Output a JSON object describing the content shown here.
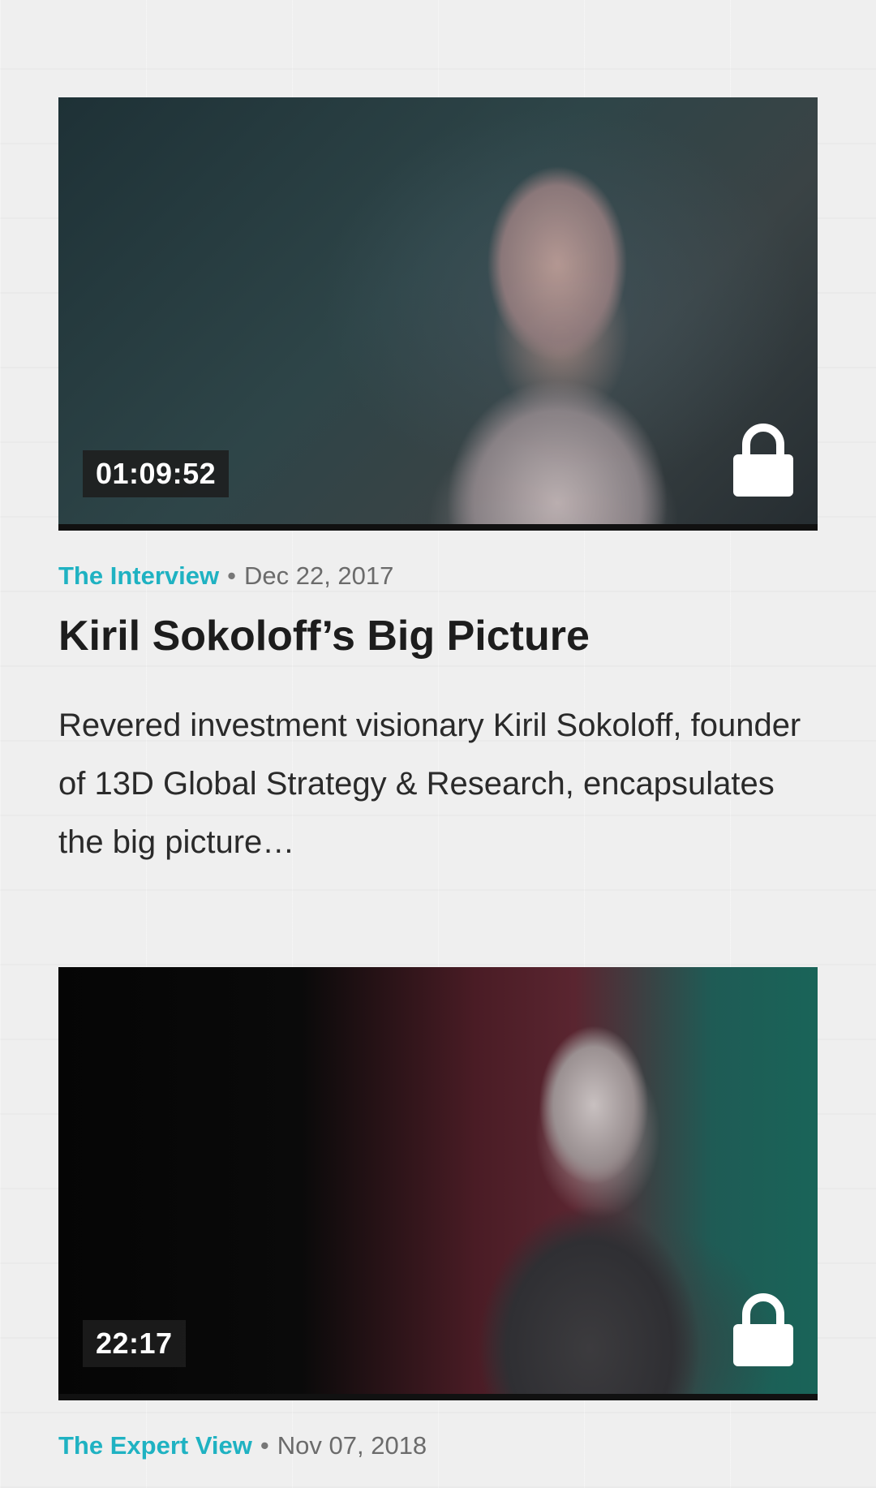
{
  "articles": [
    {
      "duration": "01:09:52",
      "category": "The Interview",
      "separator": "•",
      "date": "Dec 22, 2017",
      "title": "Kiril Sokoloff’s Big Picture",
      "description": "Revered investment visionary Kiril Sokoloff, founder of 13D Global Strategy & Research, encapsulates the big picture…",
      "locked": true,
      "lock_icon": "lock-icon"
    },
    {
      "duration": "22:17",
      "category": "The Expert View",
      "separator": "•",
      "date": "Nov 07, 2018",
      "locked": true,
      "lock_icon": "lock-icon"
    }
  ],
  "colors": {
    "accent": "#1fb2c2",
    "background": "#efefef",
    "text": "#1d1d1d"
  }
}
